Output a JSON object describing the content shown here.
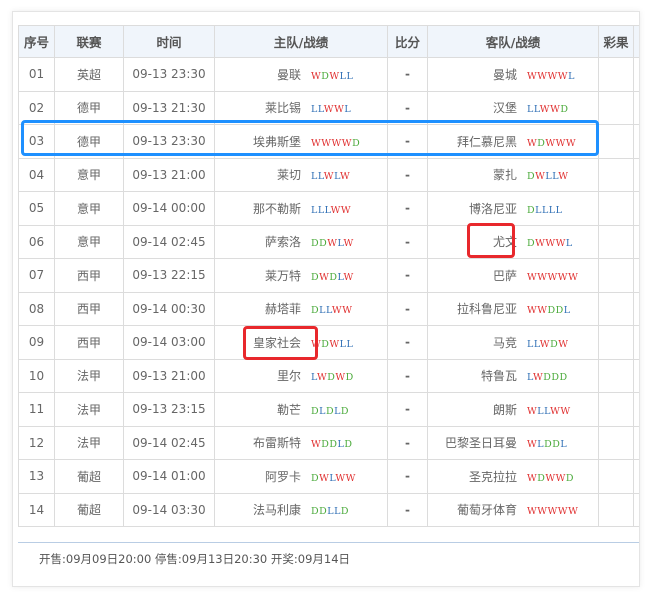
{
  "header": {
    "no": "序号",
    "league": "联赛",
    "time": "时间",
    "home": "主队/战绩",
    "score": "比分",
    "away": "客队/战绩",
    "lottery": "彩果"
  },
  "rows": [
    {
      "no": "01",
      "league": "英超",
      "time": "09-13 23:30",
      "home": "曼联",
      "home_rec": "WDWLL",
      "score": "-",
      "away": "曼城",
      "away_rec": "WWWWL"
    },
    {
      "no": "02",
      "league": "德甲",
      "time": "09-13 21:30",
      "home": "莱比锡",
      "home_rec": "LLWWL",
      "score": "-",
      "away": "汉堡",
      "away_rec": "LLWWD"
    },
    {
      "no": "03",
      "league": "德甲",
      "time": "09-13 23:30",
      "home": "埃弗斯堡",
      "home_rec": "WWWWD",
      "score": "-",
      "away": "拜仁慕尼黑",
      "away_rec": "WDWWW"
    },
    {
      "no": "04",
      "league": "意甲",
      "time": "09-13 21:00",
      "home": "莱切",
      "home_rec": "LLWLW",
      "score": "-",
      "away": "蒙扎",
      "away_rec": "DWLLW"
    },
    {
      "no": "05",
      "league": "意甲",
      "time": "09-14 00:00",
      "home": "那不勒斯",
      "home_rec": "LLLWW",
      "score": "-",
      "away": "博洛尼亚",
      "away_rec": "DLLLL"
    },
    {
      "no": "06",
      "league": "意甲",
      "time": "09-14 02:45",
      "home": "萨索洛",
      "home_rec": "DDWLW",
      "score": "-",
      "away": "尤文",
      "away_rec": "DWWWL"
    },
    {
      "no": "07",
      "league": "西甲",
      "time": "09-13 22:15",
      "home": "莱万特",
      "home_rec": "DWDLW",
      "score": "-",
      "away": "巴萨",
      "away_rec": "WWWWW"
    },
    {
      "no": "08",
      "league": "西甲",
      "time": "09-14 00:30",
      "home": "赫塔菲",
      "home_rec": "DLLWW",
      "score": "-",
      "away": "拉科鲁尼亚",
      "away_rec": "WWDDL"
    },
    {
      "no": "09",
      "league": "西甲",
      "time": "09-14 03:00",
      "home": "皇家社会",
      "home_rec": "WDWLL",
      "score": "-",
      "away": "马竞",
      "away_rec": "LLWDW"
    },
    {
      "no": "10",
      "league": "法甲",
      "time": "09-13 21:00",
      "home": "里尔",
      "home_rec": "LWDWD",
      "score": "-",
      "away": "特鲁瓦",
      "away_rec": "LWDDD"
    },
    {
      "no": "11",
      "league": "法甲",
      "time": "09-13 23:15",
      "home": "勒芒",
      "home_rec": "DLDLD",
      "score": "-",
      "away": "朗斯",
      "away_rec": "WLLWW"
    },
    {
      "no": "12",
      "league": "法甲",
      "time": "09-14 02:45",
      "home": "布雷斯特",
      "home_rec": "WDDLD",
      "score": "-",
      "away": "巴黎圣日耳曼",
      "away_rec": "WLDDL"
    },
    {
      "no": "13",
      "league": "葡超",
      "time": "09-14 01:00",
      "home": "阿罗卡",
      "home_rec": "DWLWW",
      "score": "-",
      "away": "圣克拉拉",
      "away_rec": "WDWWD"
    },
    {
      "no": "14",
      "league": "葡超",
      "time": "09-14 03:30",
      "home": "法马利康",
      "home_rec": "DDLLD",
      "score": "-",
      "away": "葡萄牙体育",
      "away_rec": "WWWWW"
    }
  ],
  "footer": "开售:09月09日20:00 停售:09月13日20:30 开奖:09月14日",
  "colors": {
    "win": "#e03030",
    "draw": "#4aaa3a",
    "loss": "#2f6fb5",
    "team": "#2f6fb5",
    "header_bg": "#f0f5fb",
    "highlight_blue": "#1e90ff",
    "highlight_red": "#e8282c"
  }
}
